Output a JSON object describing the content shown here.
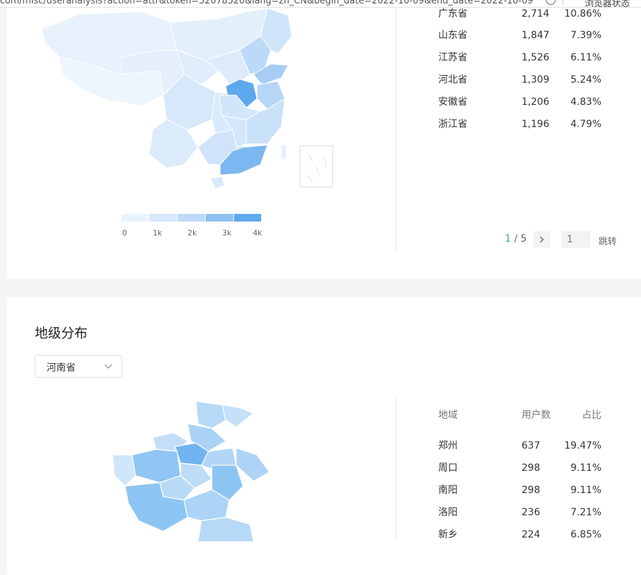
{
  "browser": {
    "url_fragment": "com/misc/useranalysis?action=attr&token=52078520&lang=zh_CN&begin_date=2022-10-09&end_date=2022-10-09",
    "extension_text": "浏览器状态"
  },
  "province_table": {
    "rows": [
      {
        "region": "广东省",
        "users": "2,714",
        "pct": "10.86%"
      },
      {
        "region": "山东省",
        "users": "1,847",
        "pct": "7.39%"
      },
      {
        "region": "江苏省",
        "users": "1,526",
        "pct": "6.11%"
      },
      {
        "region": "河北省",
        "users": "1,309",
        "pct": "5.24%"
      },
      {
        "region": "安徽省",
        "users": "1,206",
        "pct": "4.83%"
      },
      {
        "region": "浙江省",
        "users": "1,196",
        "pct": "4.79%"
      }
    ],
    "pagination": {
      "current": "1",
      "separator": " / ",
      "total": "5",
      "next_icon": "chevron-right-icon",
      "input_placeholder": "1",
      "go_label": "跳转"
    }
  },
  "map_legend": {
    "ticks": [
      "0",
      "1k",
      "2k",
      "3k",
      "4k"
    ],
    "colors": [
      "#eaf3fd",
      "#d7e8fb",
      "#bcdaf8",
      "#8ec2f3",
      "#5ea8ee"
    ]
  },
  "city_section": {
    "title": "地级分布",
    "province_select": {
      "value": "河南省",
      "icon": "chevron-down-icon"
    },
    "table": {
      "headers": {
        "region": "地域",
        "users": "用户数",
        "pct": "占比"
      },
      "rows": [
        {
          "region": "郑州",
          "users": "637",
          "pct": "19.47%"
        },
        {
          "region": "周口",
          "users": "298",
          "pct": "9.11%"
        },
        {
          "region": "南阳",
          "users": "298",
          "pct": "9.11%"
        },
        {
          "region": "洛阳",
          "users": "236",
          "pct": "7.21%"
        },
        {
          "region": "新乡",
          "users": "224",
          "pct": "6.85%"
        }
      ]
    }
  }
}
